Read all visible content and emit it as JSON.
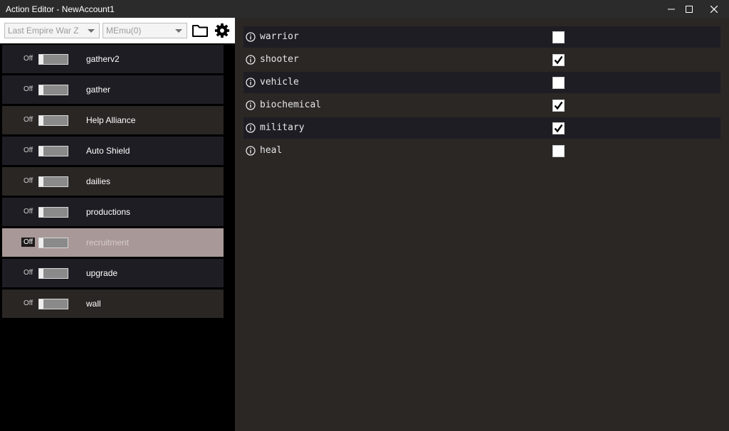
{
  "window": {
    "title": "Action Editor - NewAccount1"
  },
  "toolbar": {
    "game_select": "Last Empire War Z",
    "emulator_select": "MEmu(0)"
  },
  "actions": [
    {
      "state": "Off",
      "label": "gatherv2"
    },
    {
      "state": "Off",
      "label": "gather"
    },
    {
      "state": "Off",
      "label": "Help Alliance"
    },
    {
      "state": "Off",
      "label": "Auto Shield"
    },
    {
      "state": "Off",
      "label": "dailies"
    },
    {
      "state": "Off",
      "label": "productions"
    },
    {
      "state": "Off",
      "label": "recruitment"
    },
    {
      "state": "Off",
      "label": "upgrade"
    },
    {
      "state": "Off",
      "label": "wall"
    }
  ],
  "properties": [
    {
      "label": "warrior",
      "checked": false
    },
    {
      "label": "shooter",
      "checked": true
    },
    {
      "label": "vehicle",
      "checked": false
    },
    {
      "label": "biochemical",
      "checked": true
    },
    {
      "label": "military",
      "checked": true
    },
    {
      "label": "heal",
      "checked": false
    }
  ]
}
